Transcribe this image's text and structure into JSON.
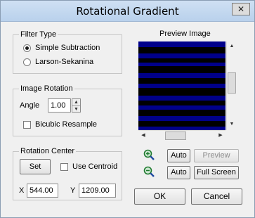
{
  "window": {
    "title": "Rotational Gradient",
    "close_symbol": "✕"
  },
  "filter_type": {
    "label": "Filter Type",
    "options": [
      {
        "label": "Simple Subtraction",
        "selected": true
      },
      {
        "label": "Larson-Sekanina",
        "selected": false
      }
    ]
  },
  "image_rotation": {
    "label": "Image Rotation",
    "angle_label": "Angle",
    "angle_value": "1.00",
    "bicubic_label": "Bicubic Resample",
    "bicubic_checked": false
  },
  "rotation_center": {
    "label": "Rotation Center",
    "set_label": "Set",
    "use_centroid_label": "Use Centroid",
    "use_centroid_checked": false,
    "x_label": "X",
    "x_value": "544.00",
    "y_label": "Y",
    "y_value": "1209.00"
  },
  "preview": {
    "label": "Preview Image",
    "auto_label_1": "Auto",
    "preview_button": "Preview",
    "auto_label_2": "Auto",
    "full_screen_label": "Full Screen"
  },
  "actions": {
    "ok_label": "OK",
    "cancel_label": "Cancel"
  },
  "colors": {
    "preview_blue": "#00008a",
    "zoom_icon": "#1f7a2f"
  }
}
